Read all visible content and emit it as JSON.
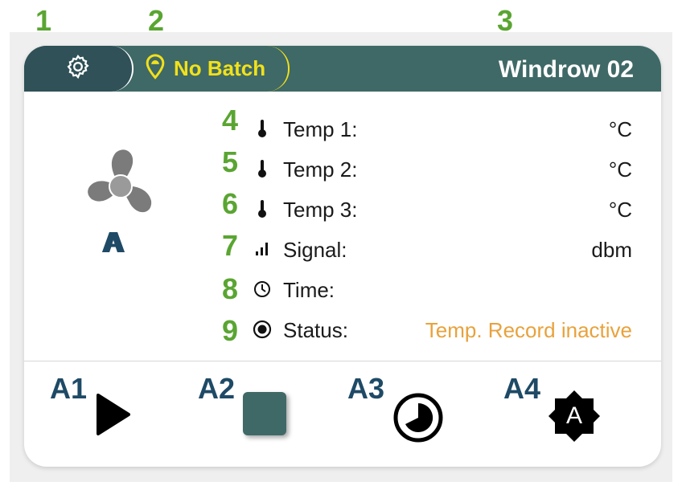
{
  "callouts": {
    "c1": "1",
    "c2": "2",
    "c3": "3",
    "c4": "4",
    "c5": "5",
    "c6": "6",
    "c7": "7",
    "c8": "8",
    "c9": "9",
    "a": "A",
    "a1": "A1",
    "a2": "A2",
    "a3": "A3",
    "a4": "A4"
  },
  "header": {
    "settings_icon": "gear-icon",
    "batch_icon": "location-pin-icon",
    "batch_label": "No Batch",
    "title": "Windrow 02"
  },
  "fan": {
    "icon": "fan-icon",
    "mode": "A"
  },
  "readings": [
    {
      "icon": "thermometer-icon",
      "label": "Temp 1:",
      "value": "°C"
    },
    {
      "icon": "thermometer-icon",
      "label": "Temp 2:",
      "value": "°C"
    },
    {
      "icon": "thermometer-icon",
      "label": "Temp 3:",
      "value": "°C"
    },
    {
      "icon": "signal-bars-icon",
      "label": "Signal:",
      "value": "dbm"
    },
    {
      "icon": "clock-icon",
      "label": "Time:",
      "value": ""
    },
    {
      "icon": "radio-icon",
      "label": "Status:",
      "value": "Temp. Record inactive"
    }
  ],
  "actions": {
    "play": "play-icon",
    "stop": "stop-icon",
    "schedule": "pie-timer-icon",
    "auto": "auto-badge-icon",
    "auto_letter": "A"
  },
  "colors": {
    "header": "#3f6966",
    "header_dark": "#2f5157",
    "batch_yellow": "#f2e11a",
    "callout_green": "#5aa532",
    "callout_navy": "#1e4a66",
    "status_orange": "#e8a23c"
  }
}
